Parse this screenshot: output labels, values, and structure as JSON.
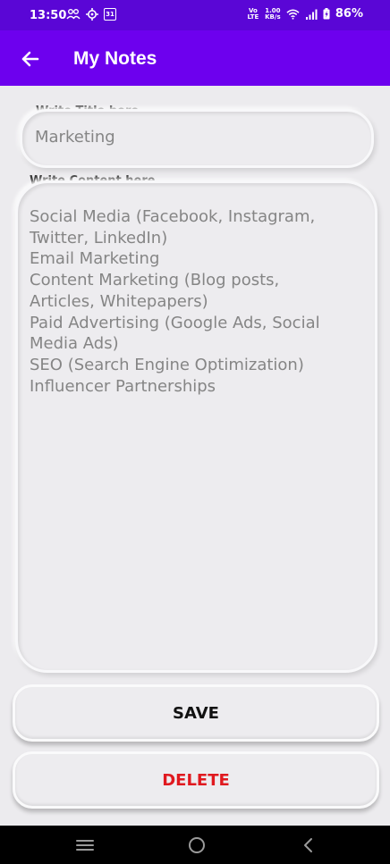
{
  "status_bar": {
    "time": "13:50",
    "network_type": "Vo LTE",
    "data_speed_value": "1.00",
    "data_speed_unit": "KB/s",
    "battery_percent": "86%",
    "calendar_day": "31"
  },
  "app_bar": {
    "title": "My Notes",
    "color": "#6d00ee"
  },
  "form": {
    "title_label": "Write Title here...",
    "title_value": "Marketing",
    "content_label": "Write Content here...",
    "content_lines": [
      "Social Media (Facebook, Instagram,",
      "Twitter, LinkedIn)",
      "Email Marketing",
      "Content Marketing (Blog posts,",
      "Articles, Whitepapers)",
      "Paid Advertising (Google Ads, Social",
      "Media Ads)",
      "SEO (Search Engine Optimization)",
      "Influencer Partnerships"
    ]
  },
  "buttons": {
    "save_label": "SAVE",
    "delete_label": "DELETE",
    "delete_color": "#e0191f"
  },
  "nav_icons": [
    "menu-icon",
    "home-icon",
    "back-icon"
  ]
}
